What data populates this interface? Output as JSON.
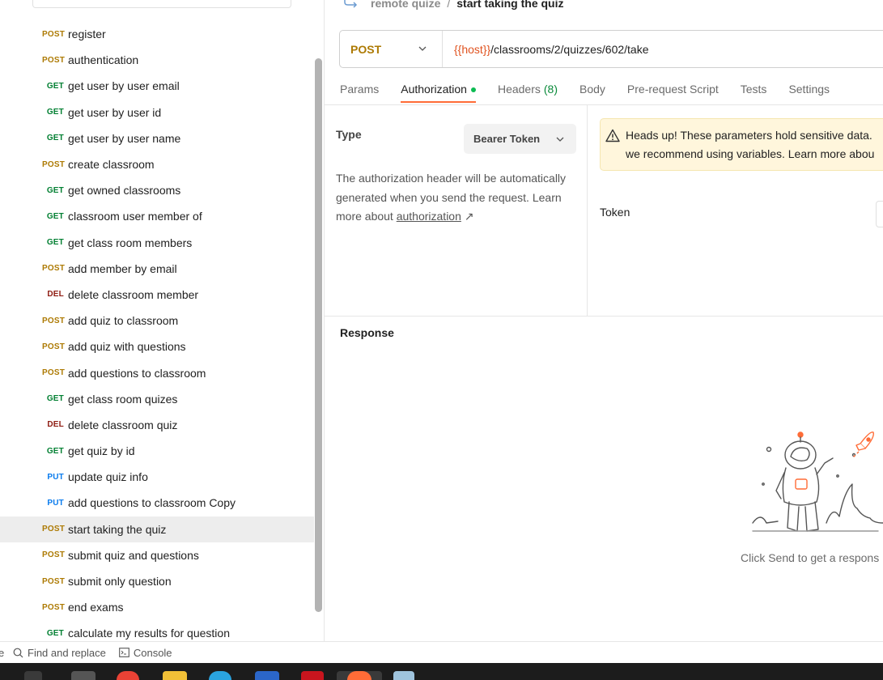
{
  "breadcrumb": {
    "parent": "remote quize",
    "separator": "/",
    "current": "start taking the quiz"
  },
  "sidebar": {
    "top_mark": "-",
    "items": [
      {
        "method": "POST",
        "label": "register",
        "level": 1
      },
      {
        "method": "POST",
        "label": "authentication",
        "level": 1
      },
      {
        "method": "GET",
        "label": "get user by user email",
        "level": 2
      },
      {
        "method": "GET",
        "label": "get user by user id",
        "level": 2
      },
      {
        "method": "GET",
        "label": "get user by user name",
        "level": 2
      },
      {
        "method": "POST",
        "label": "create classroom",
        "level": 1
      },
      {
        "method": "GET",
        "label": "get owned classrooms",
        "level": 2
      },
      {
        "method": "GET",
        "label": "classroom user member of",
        "level": 2
      },
      {
        "method": "GET",
        "label": "get class room members",
        "level": 2
      },
      {
        "method": "POST",
        "label": "add member by email",
        "level": 1
      },
      {
        "method": "DEL",
        "label": "delete classroom member",
        "level": 2
      },
      {
        "method": "POST",
        "label": "add quiz to classroom",
        "level": 1
      },
      {
        "method": "POST",
        "label": "add quiz with questions",
        "level": 1
      },
      {
        "method": "POST",
        "label": "add questions to classroom",
        "level": 1
      },
      {
        "method": "GET",
        "label": "get class room quizes",
        "level": 2
      },
      {
        "method": "DEL",
        "label": "delete classroom quiz",
        "level": 2
      },
      {
        "method": "GET",
        "label": "get quiz by id",
        "level": 2
      },
      {
        "method": "PUT",
        "label": "update quiz info",
        "level": 2
      },
      {
        "method": "PUT",
        "label": "add questions to classroom Copy",
        "level": 2
      },
      {
        "method": "POST",
        "label": "start taking the quiz",
        "level": 1,
        "active": true
      },
      {
        "method": "POST",
        "label": "submit quiz and questions",
        "level": 1
      },
      {
        "method": "POST",
        "label": "submit only question",
        "level": 1
      },
      {
        "method": "POST",
        "label": "end exams",
        "level": 1
      },
      {
        "method": "GET",
        "label": "calculate my results for question",
        "level": 2
      }
    ]
  },
  "request": {
    "method": "POST",
    "url_var": "{{host}}",
    "url_path": "/classrooms/2/quizzes/602/take"
  },
  "tabs": [
    {
      "label": "Params"
    },
    {
      "label": "Authorization",
      "active": true,
      "dot": true
    },
    {
      "label": "Headers",
      "count": "(8)"
    },
    {
      "label": "Body"
    },
    {
      "label": "Pre-request Script"
    },
    {
      "label": "Tests"
    },
    {
      "label": "Settings"
    }
  ],
  "auth": {
    "type_label": "Type",
    "type_value": "Bearer Token",
    "description": "The authorization header will be automatically generated when you send the request. Learn more about",
    "link_text": "authorization",
    "link_arrow": "↗",
    "warning_line1": "Heads up! These parameters hold sensitive data.",
    "warning_line2": "we recommend using variables. Learn more abou",
    "token_label": "Token"
  },
  "response": {
    "title": "Response",
    "hint": "Click Send to get a respons"
  },
  "statusbar": {
    "edge": "e",
    "find_replace": "Find and replace",
    "console": "Console"
  },
  "colors": {
    "post": "#ad7a03",
    "get": "#007f31",
    "del": "#8e1a10",
    "put": "#097bed",
    "accent": "#ff6c37",
    "variable": "#e05320",
    "warning_bg": "#fff6dc"
  },
  "icons": {
    "warning": "warning-triangle-icon",
    "search": "search-icon",
    "console": "console-icon",
    "chevron": "chevron-down-icon"
  }
}
